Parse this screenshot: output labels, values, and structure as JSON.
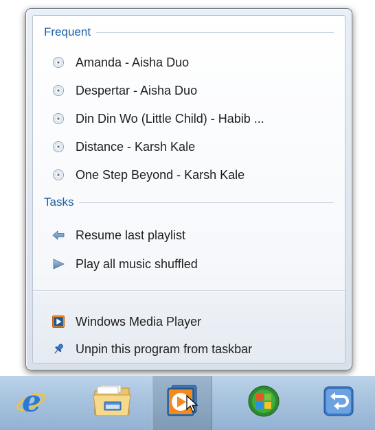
{
  "jump_list": {
    "frequent": {
      "title": "Frequent",
      "items": [
        {
          "label": "Amanda - Aisha Duo",
          "icon": "music-disc-icon"
        },
        {
          "label": "Despertar - Aisha Duo",
          "icon": "music-disc-icon"
        },
        {
          "label": "Din Din Wo (Little Child) - Habib ...",
          "icon": "music-disc-icon"
        },
        {
          "label": "Distance - Karsh Kale",
          "icon": "music-disc-icon"
        },
        {
          "label": "One Step Beyond - Karsh Kale",
          "icon": "music-disc-icon"
        }
      ]
    },
    "tasks": {
      "title": "Tasks",
      "items": [
        {
          "label": "Resume last playlist",
          "icon": "back-arrow-icon"
        },
        {
          "label": "Play all music shuffled",
          "icon": "play-triangle-icon"
        }
      ]
    },
    "footer": {
      "app_label": "Windows Media Player",
      "unpin_label": "Unpin this program from taskbar"
    }
  },
  "taskbar": {
    "buttons": [
      {
        "name": "Internet Explorer",
        "icon": "internet-explorer-icon"
      },
      {
        "name": "Windows Explorer",
        "icon": "folder-library-icon"
      },
      {
        "name": "Windows Media Player",
        "icon": "media-player-icon",
        "active": true
      },
      {
        "name": "Windows Media Center",
        "icon": "media-center-icon"
      },
      {
        "name": "Remote Desktop",
        "icon": "remote-desktop-icon"
      }
    ]
  },
  "colors": {
    "category_title": "#1e5fa8",
    "taskbar": "#a9c4df",
    "media_player_orange": "#f28a1e"
  }
}
